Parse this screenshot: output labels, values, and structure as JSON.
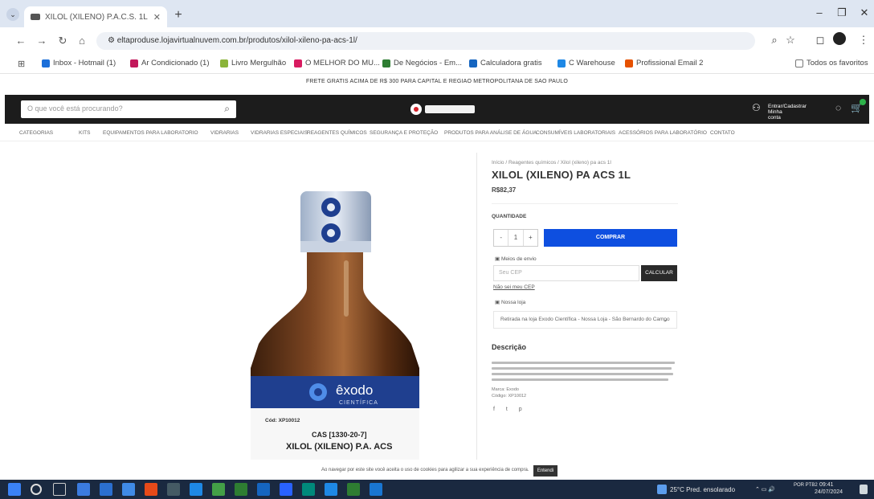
{
  "browser": {
    "tab_title": "XILOL (XILENO) P.A.C.S. 1L",
    "tab_close": "✕",
    "new_tab": "+",
    "url": "eltaproduse.lojavirtualnuvem.com.br/produtos/xilol-xileno-pa-acs-1l/",
    "bookmarks": [
      {
        "label": "Inbox - Hotmail (1)",
        "color": "#1c6fd9"
      },
      {
        "label": "Ar Condicionado (1)",
        "color": "#c2185b"
      },
      {
        "label": "Livro Mergulhão",
        "color": "#8bb43a"
      },
      {
        "label": "O MELHOR DO MU...",
        "color": "#d81b60"
      },
      {
        "label": "De Negócios - Em...",
        "color": "#2e7d32"
      },
      {
        "label": "Calculadora gratis",
        "color": "#1565c0"
      },
      {
        "label": "C Warehouse",
        "color": "#1e88e5"
      },
      {
        "label": "Profissional Email 2",
        "color": "#e65100"
      }
    ],
    "other_bookmarks": "Todos os favoritos"
  },
  "site": {
    "announcement": "FRETE GRATIS ACIMA DE R$ 300 PARA CAPITAL E REGIAO METROPOLITANA DE SAO PAULO",
    "search_placeholder": "O que você está procurando?",
    "account_line1": "Entrar/Cadastrar",
    "account_line2": "Minha conta",
    "categories": [
      "Categorias",
      "Kits",
      "Equipamentos para laboratorio",
      "Vidrarias",
      "Vidrarias especiais",
      "Reagentes químicos",
      "Segurança e proteção",
      "Produtos para análise de água",
      "Consumíveis laboratoriais",
      "Acessórios para laboratório",
      "Contato"
    ]
  },
  "product": {
    "breadcrumb": "Início / Reagentes químicos / Xilol (xileno) pa acs 1l",
    "title": "XILOL (XILENO) PA ACS 1L",
    "price": "R$82,37",
    "qty_label": "QUANTIDADE",
    "qty_minus": "-",
    "qty_value": "1",
    "qty_plus": "+",
    "buy_label": "COMPRAR",
    "shipping_label": "Meios de envio",
    "cep_placeholder": "Seu CEP",
    "cep_button": "CALCULAR",
    "cep_link": "Não sei meu CEP",
    "stock_label": "Nossa loja",
    "store_option": "Retirada na loja Exodo Científica - Nossa Loja - São Bernardo do Campo",
    "store_chevron": "⌄",
    "description_title": "Descrição",
    "desc_meta1": "Marca: Exodo",
    "desc_meta2": "Código: XP10012",
    "share_icons": "f t p",
    "bottle_brand": "êxodo",
    "bottle_sub": "CIENTÍFICA",
    "bottle_cas": "CAS [1330-20-7]",
    "bottle_name": "XILOL (XILENO) P.A. ACS",
    "bottle_code": "Cód: XP10012"
  },
  "cookie": {
    "text": "Ao navegar por este site você aceita o uso de cookies para agilizar a sua experiência de compra.",
    "button": "Entendi"
  },
  "taskbar": {
    "weather": "25°C Pred. ensolarado",
    "time": "09:41",
    "date": "24/07/2024",
    "lang": "POR PTB2"
  }
}
